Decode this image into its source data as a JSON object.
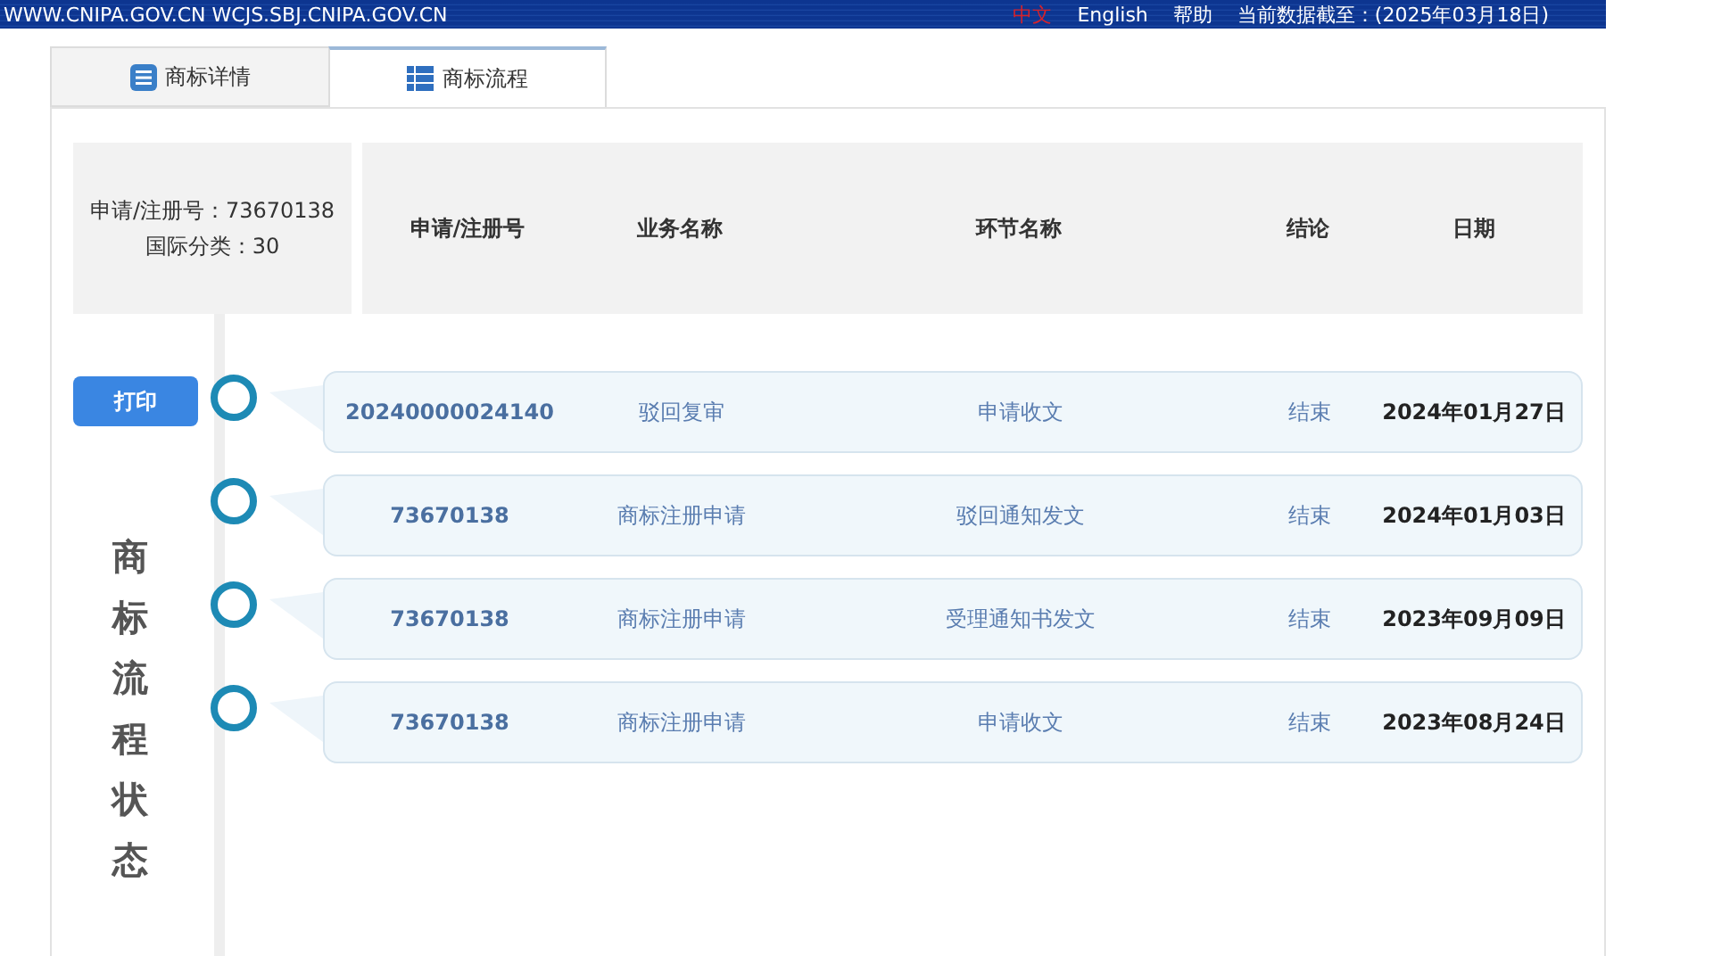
{
  "top_bar": {
    "site": "WWW.CNIPA.GOV.CN WCJS.SBJ.CNIPA.GOV.CN",
    "languages": [
      {
        "label": "中文",
        "selected": true
      },
      {
        "label": "English",
        "selected": false
      }
    ],
    "help": "帮助",
    "data_date": "当前数据截至：(2025年03月18日)"
  },
  "tabs": [
    {
      "label": "商标详情",
      "selected": false,
      "kind": "details"
    },
    {
      "label": "商标流程",
      "selected": true,
      "kind": "grid"
    }
  ],
  "summary": {
    "registration": "申请/注册号：73670138",
    "class": "国际分类：30"
  },
  "columns": [
    "申请/注册号",
    "业务名称",
    "环节名称",
    "结论",
    "日期"
  ],
  "print_button": "打印",
  "side_label": "商标流程状态",
  "rows": [
    {
      "number": "20240000024140",
      "business": "驳回复审",
      "stage": "申请收文",
      "conclusion": "结束",
      "date": "2024年01月27日"
    },
    {
      "number": "73670138",
      "business": "商标注册申请",
      "stage": "驳回通知发文",
      "conclusion": "结束",
      "date": "2024年01月03日"
    },
    {
      "number": "73670138",
      "business": "商标注册申请",
      "stage": "受理通知书发文",
      "conclusion": "结束",
      "date": "2023年09月09日"
    },
    {
      "number": "73670138",
      "business": "商标注册申请",
      "stage": "申请收文",
      "conclusion": "结束",
      "date": "2023年08月24日"
    }
  ]
}
